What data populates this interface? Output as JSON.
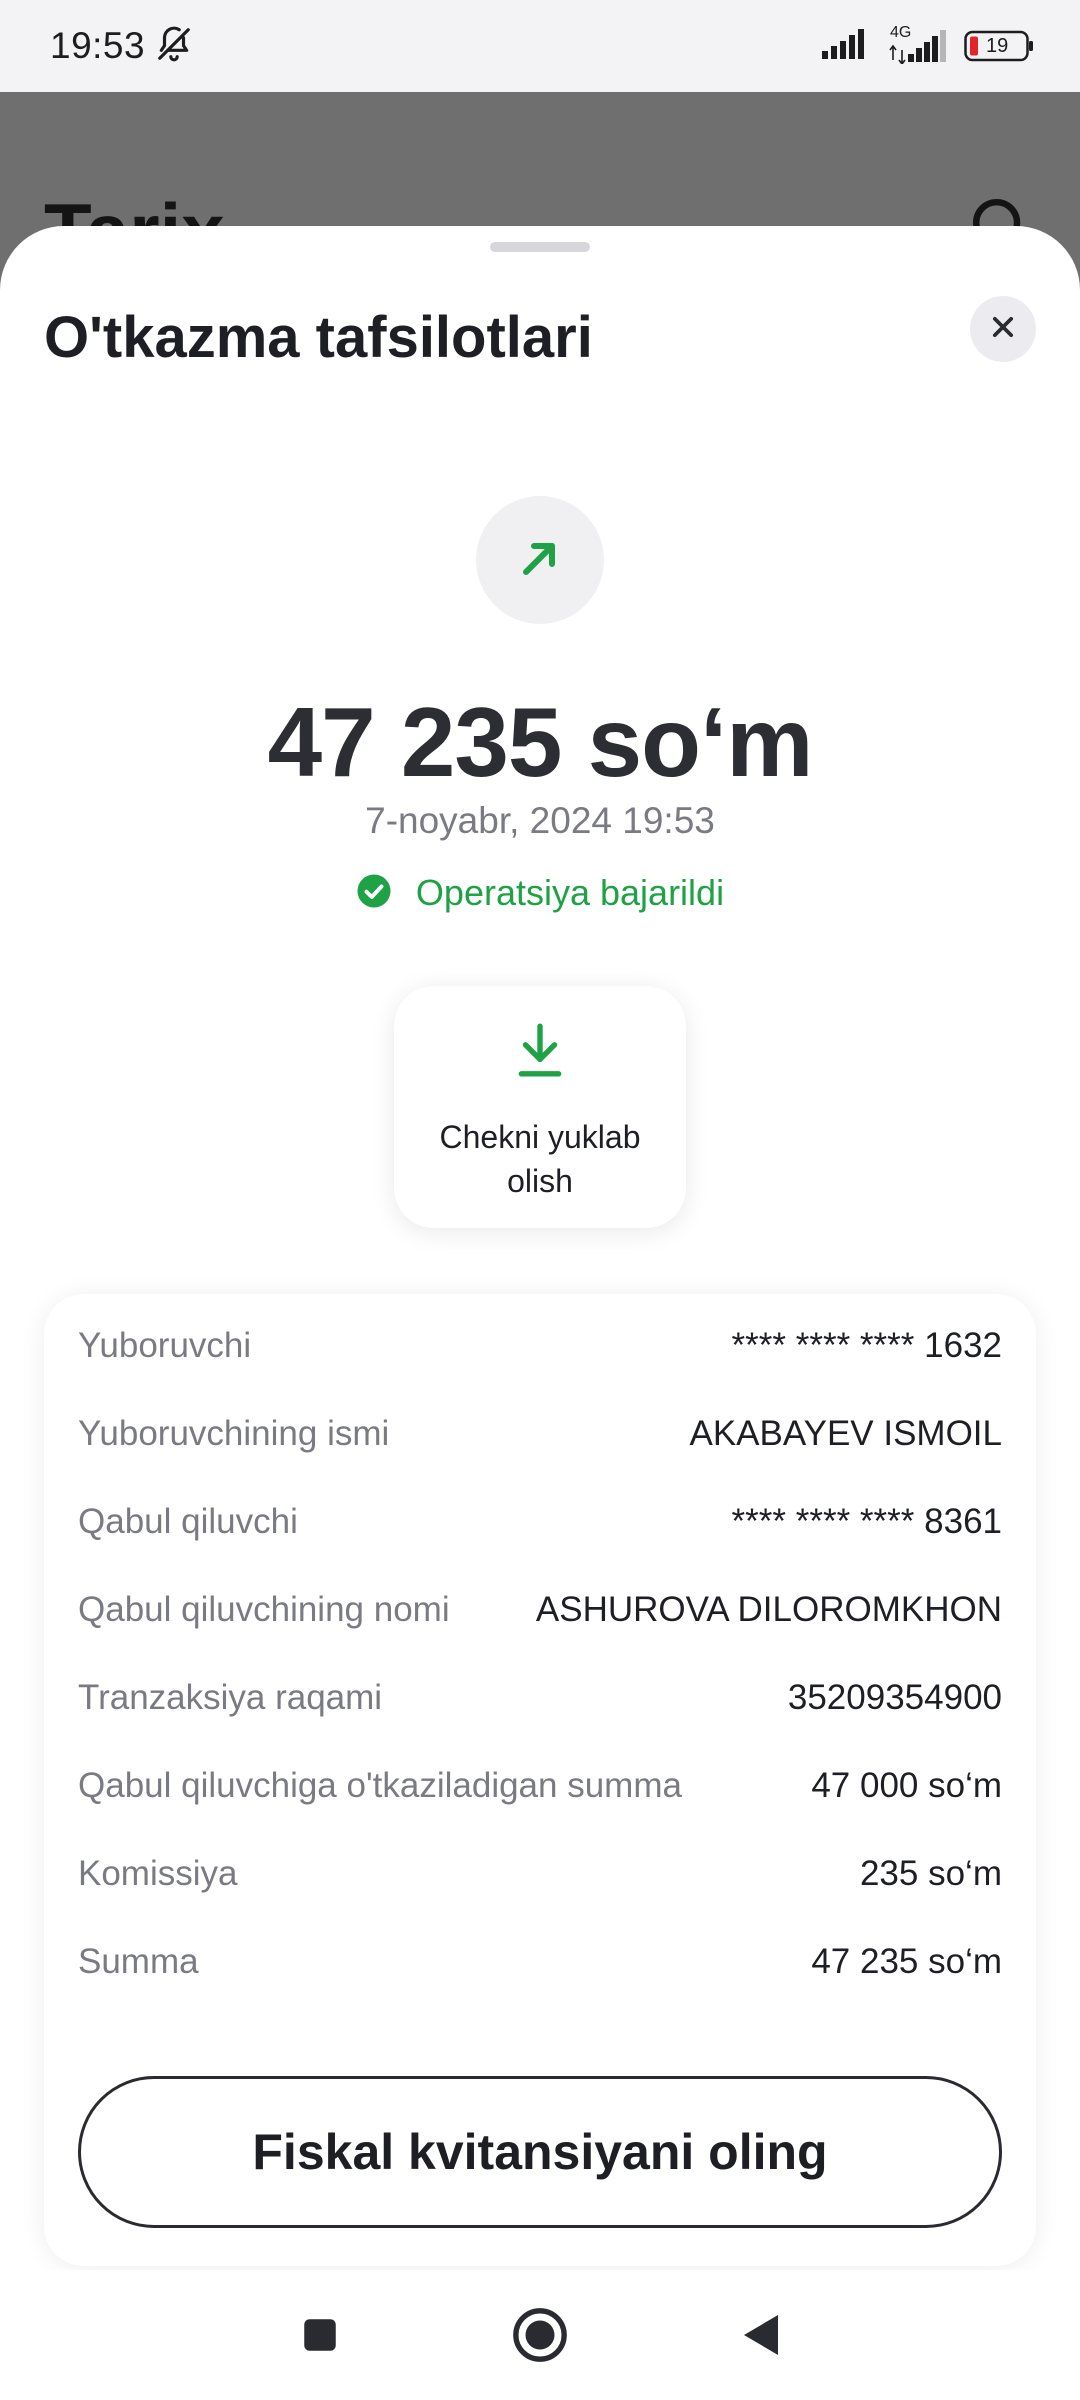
{
  "status_bar": {
    "time": "19:53",
    "icons": [
      "bell-off-icon",
      "signal-icon",
      "signal-4g-icon",
      "battery-icon"
    ],
    "network": "4G",
    "battery": "19"
  },
  "background": {
    "title": "Tarix",
    "icon": "search-icon"
  },
  "sheet": {
    "title": "O'tkazma tafsilotlari",
    "close_icon": "close-icon",
    "transfer_icon": "arrow-up-right-icon",
    "amount": "47 235 so‘m",
    "date": "7-noyabr, 2024 19:53",
    "status": "Operatsiya bajarildi",
    "status_icon": "check-circle-icon",
    "receipt_button": {
      "icon": "download-icon",
      "label": "Chekni yuklab olish"
    },
    "details": [
      {
        "label": "Yuboruvchi",
        "value": "**** **** **** 1632"
      },
      {
        "label": "Yuboruvchining ismi",
        "value": "AKABAYEV ISMOIL"
      },
      {
        "label": "Qabul qiluvchi",
        "value": "**** **** **** 8361"
      },
      {
        "label": "Qabul qiluvchining nomi",
        "value": "ASHUROVA DILOROMKHON"
      },
      {
        "label": "Tranzaksiya raqami",
        "value": "35209354900"
      },
      {
        "label": "Qabul qiluvchiga o'tkaziladigan summa",
        "value": "47 000 so‘m"
      },
      {
        "label": "Komissiya",
        "value": "235 so‘m"
      },
      {
        "label": "Summa",
        "value": "47 235 so‘m"
      }
    ],
    "fiscal_button": "Fiskal kvitansiyani oling"
  },
  "colors": {
    "accent_green": "#1ea245",
    "text_primary": "#1e1f24",
    "text_secondary": "#7a7b82",
    "backdrop": "#6f6f70"
  },
  "nav_bar": {
    "items": [
      "recent-apps-icon",
      "home-icon",
      "back-icon"
    ]
  }
}
